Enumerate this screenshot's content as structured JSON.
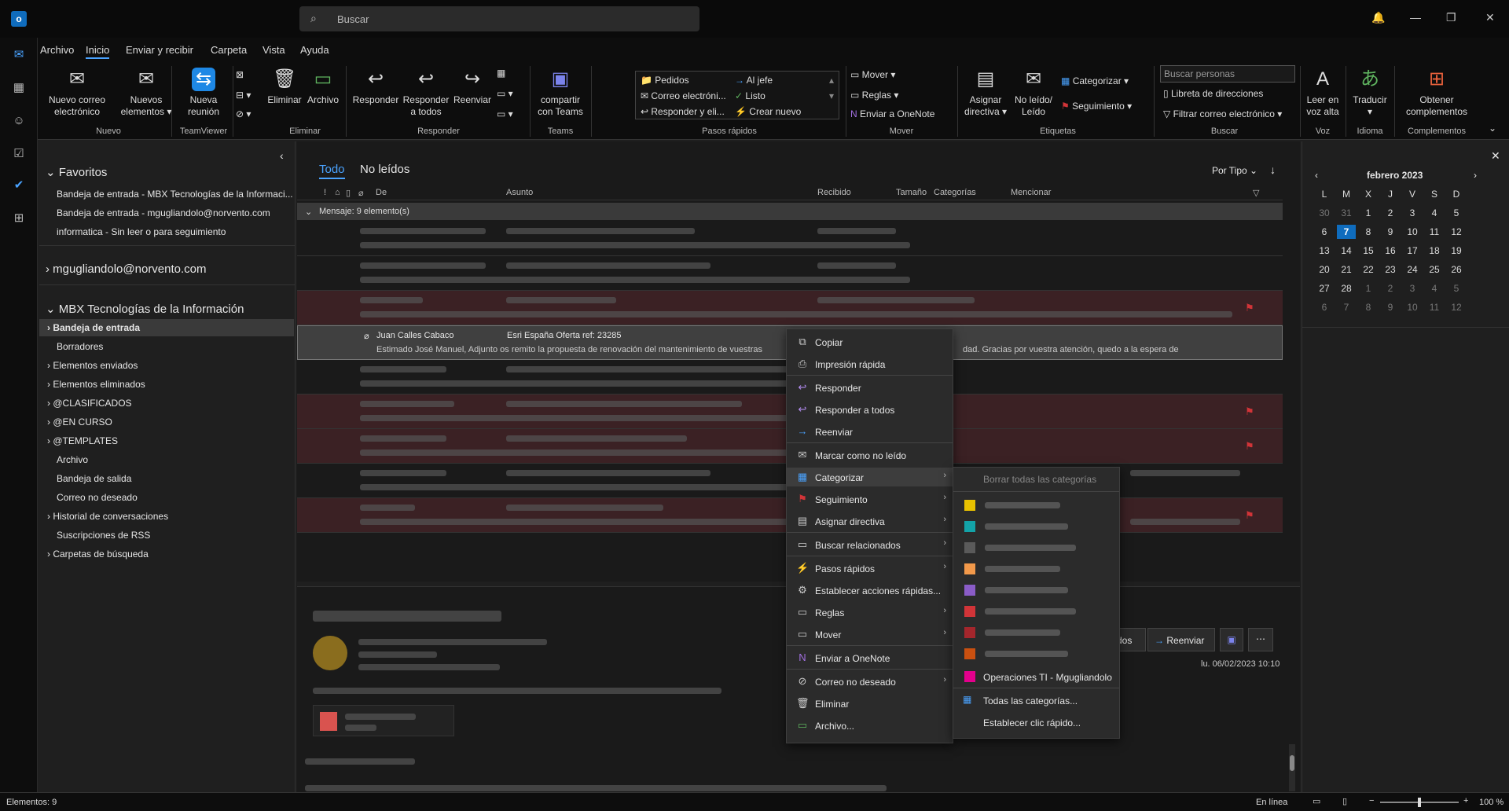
{
  "app": {
    "search_placeholder": "Buscar"
  },
  "menu": [
    "Archivo",
    "Inicio",
    "Enviar y recibir",
    "Carpeta",
    "Vista",
    "Ayuda"
  ],
  "ribbon": {
    "nuevo_correo": "Nuevo correo electrónico",
    "nuevos_elementos": "Nuevos elementos",
    "group_nuevo": "Nuevo",
    "nueva_reunion": "Nueva reunión",
    "group_teamviewer": "TeamViewer",
    "eliminar": "Eliminar",
    "archivo": "Archivo",
    "group_eliminar": "Eliminar",
    "responder": "Responder",
    "responder_todos": "Responder a todos",
    "reenviar": "Reenviar",
    "group_responder": "Responder",
    "compartir_teams": "compartir con Teams",
    "group_teams": "Teams",
    "qs_pedidos": "Pedidos",
    "qs_correo": "Correo electróni...",
    "qs_responder": "Responder y eli...",
    "qs_jefe": "Al jefe",
    "qs_listo": "Listo",
    "qs_crear": "Crear nuevo",
    "group_pasos": "Pasos rápidos",
    "mover": "Mover",
    "reglas": "Reglas",
    "onenote": "Enviar a OneNote",
    "group_mover": "Mover",
    "asignar": "Asignar directiva",
    "noleido": "No leído/ Leído",
    "categorizar": "Categorizar",
    "seguimiento": "Seguimiento",
    "group_etiquetas": "Etiquetas",
    "buscar_personas": "Buscar personas",
    "libreta": "Libreta de direcciones",
    "filtrar": "Filtrar correo electrónico",
    "group_buscar": "Buscar",
    "leer": "Leer en voz alta",
    "group_voz": "Voz",
    "traducir": "Traducir",
    "group_idioma": "Idioma",
    "obtener": "Obtener complementos",
    "group_complementos": "Complementos"
  },
  "folders": {
    "favoritos": "Favoritos",
    "fav_items": [
      "Bandeja de entrada - MBX Tecnologías de la Informaci...",
      "Bandeja de entrada - mgugliandolo@norvento.com",
      "informatica - Sin leer o para seguimiento"
    ],
    "account1": "mgugliandolo@norvento.com",
    "account2": "MBX Tecnologías de la Información",
    "items": [
      "Bandeja de entrada",
      "Borradores",
      "Elementos enviados",
      "Elementos eliminados",
      "@CLASIFICADOS",
      "@EN CURSO",
      "@TEMPLATES",
      "Archivo",
      "Bandeja de salida",
      "Correo no deseado",
      "Historial de conversaciones",
      "Suscripciones de RSS",
      "Carpetas de búsqueda"
    ]
  },
  "list": {
    "tab_all": "Todo",
    "tab_unread": "No leídos",
    "sort": "Por Tipo",
    "cols": {
      "de": "De",
      "asunto": "Asunto",
      "recibido": "Recibido",
      "tamano": "Tamaño",
      "categorias": "Categorías",
      "mencionar": "Mencionar"
    },
    "group": "Mensaje: 9 elemento(s)",
    "sel_from": "Juan Calles Cabaco",
    "sel_subject": "Esri España Oferta ref: 23285",
    "sel_preview": "Estimado José Manuel,  Adjunto os remito la propuesta de renovación del mantenimiento de vuestras",
    "sel_preview_end": "dad.  Gracias por vuestra atención, quedo a la espera de"
  },
  "reading": {
    "reenviar": "Reenviar",
    "todos_tail": "dos",
    "date": "lu. 06/02/2023 10:10"
  },
  "calendar": {
    "month": "febrero 2023",
    "days": [
      "L",
      "M",
      "X",
      "J",
      "V",
      "S",
      "D"
    ],
    "weeks": [
      [
        "30",
        "31",
        "1",
        "2",
        "3",
        "4",
        "5"
      ],
      [
        "6",
        "7",
        "8",
        "9",
        "10",
        "11",
        "12"
      ],
      [
        "13",
        "14",
        "15",
        "16",
        "17",
        "18",
        "19"
      ],
      [
        "20",
        "21",
        "22",
        "23",
        "24",
        "25",
        "26"
      ],
      [
        "27",
        "28",
        "1",
        "2",
        "3",
        "4",
        "5"
      ],
      [
        "6",
        "7",
        "8",
        "9",
        "10",
        "11",
        "12"
      ]
    ]
  },
  "ctx": {
    "copiar": "Copiar",
    "impresion": "Impresión rápida",
    "responder": "Responder",
    "responder_todos": "Responder a todos",
    "reenviar": "Reenviar",
    "marcar": "Marcar como no leído",
    "categorizar": "Categorizar",
    "seguimiento": "Seguimiento",
    "asignar": "Asignar directiva",
    "buscar": "Buscar relacionados",
    "pasos": "Pasos rápidos",
    "establecer": "Establecer acciones rápidas...",
    "reglas": "Reglas",
    "mover": "Mover",
    "onenote": "Enviar a OneNote",
    "nodeseado": "Correo no deseado",
    "eliminar": "Eliminar",
    "archivo": "Archivo..."
  },
  "submenu": {
    "borrar": "Borrar todas las categorías",
    "operaciones": "Operaciones TI - Mgugliandolo",
    "todas": "Todas las categorías...",
    "clic": "Establecer clic rápido...",
    "colors": [
      "#e8c100",
      "#13a3a8",
      "#5a5a5a",
      "#f2994a",
      "#8a5cc7",
      "#d13438",
      "#a4262c",
      "#ca5010",
      "#e3008c"
    ]
  },
  "status": {
    "elementos": "Elementos: 9",
    "enlinea": "En línea",
    "zoom": "100 %"
  }
}
